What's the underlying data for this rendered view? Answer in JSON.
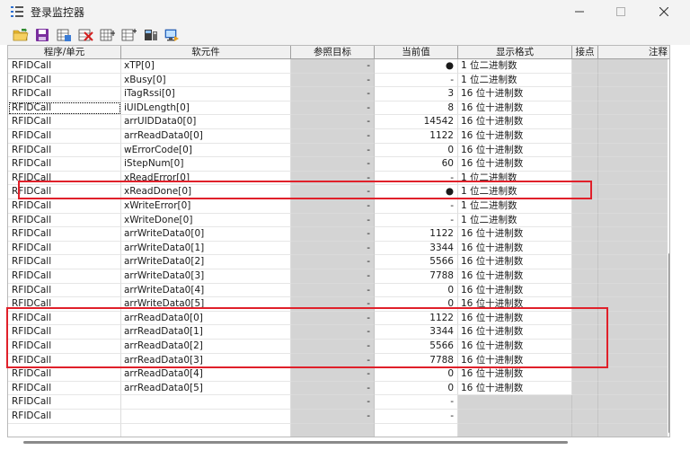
{
  "window": {
    "title": "登录监控器",
    "icon": "list-icon",
    "controls": [
      "minimize-icon",
      "maximize-icon",
      "close-icon"
    ]
  },
  "toolbar": {
    "icons": [
      "open-folder-icon",
      "save-icon",
      "grid-import-icon",
      "delete-row-icon",
      "insert-row-icon",
      "append-row-icon",
      "device-icon",
      "monitor-icon"
    ]
  },
  "colors": {
    "grid_gray": "#d4d4d4",
    "highlight_red": "#e0202a",
    "header_bg": "#f0f0f0"
  },
  "table": {
    "headers": [
      "程序/单元",
      "软元件",
      "参照目标",
      "当前值",
      "显示格式",
      "接点",
      "注释"
    ],
    "rows": [
      {
        "prog": "RFIDCall",
        "elem": "xTP[0]",
        "ref": "-",
        "val": "●",
        "fmt": "1 位二进制数"
      },
      {
        "prog": "RFIDCall",
        "elem": "xBusy[0]",
        "ref": "-",
        "val": "-",
        "fmt": "1 位二进制数"
      },
      {
        "prog": "RFIDCall",
        "elem": "iTagRssi[0]",
        "ref": "-",
        "val": "3",
        "fmt": "16 位十进制数"
      },
      {
        "prog": "RFIDCall",
        "elem": "iUIDLength[0]",
        "ref": "-",
        "val": "8",
        "fmt": "16 位十进制数"
      },
      {
        "prog": "RFIDCall",
        "elem": "arrUIDData0[0]",
        "ref": "-",
        "val": "14542",
        "fmt": "16 位十进制数"
      },
      {
        "prog": "RFIDCall",
        "elem": "arrReadData0[0]",
        "ref": "-",
        "val": "1122",
        "fmt": "16 位十进制数"
      },
      {
        "prog": "RFIDCall",
        "elem": "wErrorCode[0]",
        "ref": "-",
        "val": "0",
        "fmt": "16 位十进制数"
      },
      {
        "prog": "RFIDCall",
        "elem": "iStepNum[0]",
        "ref": "-",
        "val": "60",
        "fmt": "16 位十进制数"
      },
      {
        "prog": "RFIDCall",
        "elem": "xReadError[0]",
        "ref": "-",
        "val": "-",
        "fmt": "1 位二进制数"
      },
      {
        "prog": "RFIDCall",
        "elem": "xReadDone[0]",
        "ref": "-",
        "val": "●",
        "fmt": "1 位二进制数"
      },
      {
        "prog": "RFIDCall",
        "elem": "xWriteError[0]",
        "ref": "-",
        "val": "-",
        "fmt": "1 位二进制数"
      },
      {
        "prog": "RFIDCall",
        "elem": "xWriteDone[0]",
        "ref": "-",
        "val": "-",
        "fmt": "1 位二进制数"
      },
      {
        "prog": "RFIDCall",
        "elem": "arrWriteData0[0]",
        "ref": "-",
        "val": "1122",
        "fmt": "16 位十进制数"
      },
      {
        "prog": "RFIDCall",
        "elem": "arrWriteData0[1]",
        "ref": "-",
        "val": "3344",
        "fmt": "16 位十进制数"
      },
      {
        "prog": "RFIDCall",
        "elem": "arrWriteData0[2]",
        "ref": "-",
        "val": "5566",
        "fmt": "16 位十进制数"
      },
      {
        "prog": "RFIDCall",
        "elem": "arrWriteData0[3]",
        "ref": "-",
        "val": "7788",
        "fmt": "16 位十进制数"
      },
      {
        "prog": "RFIDCall",
        "elem": "arrWriteData0[4]",
        "ref": "-",
        "val": "0",
        "fmt": "16 位十进制数"
      },
      {
        "prog": "RFIDCall",
        "elem": "arrWriteData0[5]",
        "ref": "-",
        "val": "0",
        "fmt": "16 位十进制数"
      },
      {
        "prog": "RFIDCall",
        "elem": "arrReadData0[0]",
        "ref": "-",
        "val": "1122",
        "fmt": "16 位十进制数"
      },
      {
        "prog": "RFIDCall",
        "elem": "arrReadData0[1]",
        "ref": "-",
        "val": "3344",
        "fmt": "16 位十进制数"
      },
      {
        "prog": "RFIDCall",
        "elem": "arrReadData0[2]",
        "ref": "-",
        "val": "5566",
        "fmt": "16 位十进制数"
      },
      {
        "prog": "RFIDCall",
        "elem": "arrReadData0[3]",
        "ref": "-",
        "val": "7788",
        "fmt": "16 位十进制数"
      },
      {
        "prog": "RFIDCall",
        "elem": "arrReadData0[4]",
        "ref": "-",
        "val": "0",
        "fmt": "16 位十进制数"
      },
      {
        "prog": "RFIDCall",
        "elem": "arrReadData0[5]",
        "ref": "-",
        "val": "0",
        "fmt": "16 位十进制数"
      },
      {
        "prog": "RFIDCall",
        "elem": "",
        "ref": "-",
        "val": "-",
        "fmt": ""
      },
      {
        "prog": "RFIDCall",
        "elem": "",
        "ref": "-",
        "val": "-",
        "fmt": ""
      },
      {
        "prog": "",
        "elem": "",
        "ref": "",
        "val": "",
        "fmt": ""
      }
    ]
  }
}
